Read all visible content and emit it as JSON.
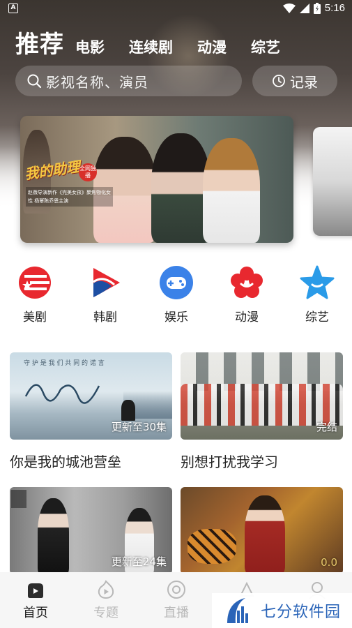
{
  "status": {
    "time": "5:16",
    "notif": "A"
  },
  "tabs": {
    "main": "推荐",
    "items": [
      "电影",
      "连续剧",
      "动漫",
      "综艺"
    ]
  },
  "search": {
    "placeholder": "影视名称、演员",
    "record_label": "记录"
  },
  "banner": {
    "title": "我的助理",
    "badge": "全网独播",
    "caption": "赵薇导演新作《完美女孩》聚焦物化女性 杨幂陈乔恩主演"
  },
  "categories": [
    {
      "label": "美剧",
      "icon": "us-flag-icon",
      "color": "#e8282f"
    },
    {
      "label": "韩剧",
      "icon": "korea-play-icon",
      "color": "#1d4fa3"
    },
    {
      "label": "娱乐",
      "icon": "gamepad-icon",
      "color": "#3b82e8"
    },
    {
      "label": "动漫",
      "icon": "flower-icon",
      "color": "#e8282f"
    },
    {
      "label": "综艺",
      "icon": "star-icon",
      "color": "#2a9be8"
    }
  ],
  "videos": [
    {
      "title": "你是我的城池营垒",
      "badge": "更新至30集",
      "thumb_text": "守 护 是 我 们 共 同 的 诺 言"
    },
    {
      "title": "别想打扰我学习",
      "badge": "完结"
    },
    {
      "title": "",
      "badge": "更新至24集"
    },
    {
      "title": "",
      "badge": "0.0"
    }
  ],
  "nav": [
    {
      "label": "首页",
      "icon": "home-icon",
      "active": true
    },
    {
      "label": "专题",
      "icon": "topic-icon",
      "active": false
    },
    {
      "label": "直播",
      "icon": "live-icon",
      "active": false
    }
  ],
  "watermark": {
    "text": "七分软件园"
  },
  "colors": {
    "accent": "#2a64b8",
    "active_nav": "#222222",
    "inactive_nav": "#b8b8b8"
  }
}
